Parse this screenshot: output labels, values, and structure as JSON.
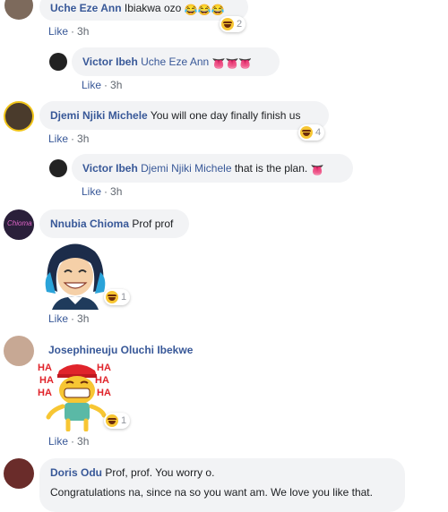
{
  "comments": [
    {
      "author": "Uche Eze Ann",
      "text": "Ibiakwa ozo",
      "emojis": "😂😂😂",
      "like": "Like",
      "sep": "·",
      "time": "3h",
      "reaction_count": "2"
    },
    {
      "author": "Victor Ibeh",
      "mention": "Uche Eze Ann",
      "emojis": "👅👅👅",
      "like": "Like",
      "sep": "·",
      "time": "3h"
    },
    {
      "author": "Djemi Njiki Michele",
      "text": "You will one day finally finish us",
      "like": "Like",
      "sep": "·",
      "time": "3h",
      "reaction_count": "4"
    },
    {
      "author": "Victor Ibeh",
      "mention": "Djemi Njiki Michele",
      "text": "that is the plan.",
      "emojis": "👅",
      "like": "Like",
      "sep": "·",
      "time": "3h"
    },
    {
      "author": "Nnubia Chioma",
      "text": "Prof prof",
      "like": "Like",
      "sep": "·",
      "time": "3h",
      "reaction_count": "1",
      "avatar_text": "Chioma"
    },
    {
      "author": "Josephineuju Oluchi Ibekwe",
      "like": "Like",
      "sep": "·",
      "time": "3h",
      "reaction_count": "1",
      "sticker_text": "HA"
    },
    {
      "author": "Doris Odu",
      "text": "Prof, prof. You worry o.",
      "text2": "Congratulations na, since na so you want am. We love you like that."
    }
  ]
}
